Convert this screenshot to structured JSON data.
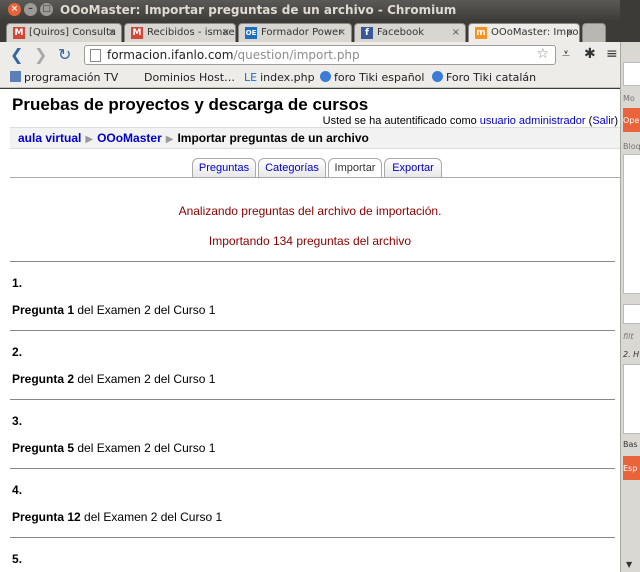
{
  "window": {
    "title": "OOoMaster: Importar preguntas de un archivo - Chromium"
  },
  "tabs": [
    {
      "label": "[Quiros] Consulta",
      "favicon": "gmail-icon",
      "color": "#d44638"
    },
    {
      "label": "Recibidos - ismae",
      "favicon": "gmail-icon",
      "color": "#d44638"
    },
    {
      "label": "Formador Power",
      "favicon": "openoffice-icon",
      "color": "#1c6fc0"
    },
    {
      "label": "Facebook",
      "favicon": "facebook-icon",
      "color": "#3b5998"
    },
    {
      "label": "OOoMaster: Impo",
      "favicon": "moodle-icon",
      "color": "#f7931e",
      "active": true
    }
  ],
  "address": {
    "host": "formacion.ifanlo.com",
    "path": "/question/import.php"
  },
  "bookmarks": [
    {
      "label": "programación TV"
    },
    {
      "label": "Dominios Host…"
    },
    {
      "label": "index.php",
      "prefix": "LE"
    },
    {
      "label": "foro Tiki español"
    },
    {
      "label": "Foro Tiki catalán"
    }
  ],
  "site": {
    "title": "Pruebas de proyectos y descarga de cursos",
    "login_prefix": "Usted se ha autentificado como",
    "login_user": "usuario administrador",
    "logout": "Salir"
  },
  "breadcrumb": {
    "home": "aula virtual",
    "course": "OOoMaster",
    "current": "Importar preguntas de un archivo"
  },
  "page_tabs": [
    {
      "label": "Preguntas"
    },
    {
      "label": "Categorías"
    },
    {
      "label": "Importar",
      "selected": true
    },
    {
      "label": "Exportar"
    }
  ],
  "messages": {
    "parsing": "Analizando preguntas del archivo de importación.",
    "importing": "Importando 134 preguntas del archivo"
  },
  "questions": [
    {
      "num": "1",
      "title": "Pregunta 1",
      "rest": "del Examen 2 del Curso 1"
    },
    {
      "num": "2",
      "title": "Pregunta 2",
      "rest": "del Examen 2 del Curso 1"
    },
    {
      "num": "3",
      "title": "Pregunta 5",
      "rest": "del Examen 2 del Curso 1"
    },
    {
      "num": "4",
      "title": "Pregunta 12",
      "rest": "del Examen 2 del Curso 1"
    },
    {
      "num": "5"
    }
  ],
  "side_panel": {
    "label_1": "Mo",
    "label_2": "Ope",
    "label_3": "Bloq",
    "label_4": "filt",
    "label_5": "2. H",
    "label_6": "Bas",
    "label_7": "Esp"
  }
}
